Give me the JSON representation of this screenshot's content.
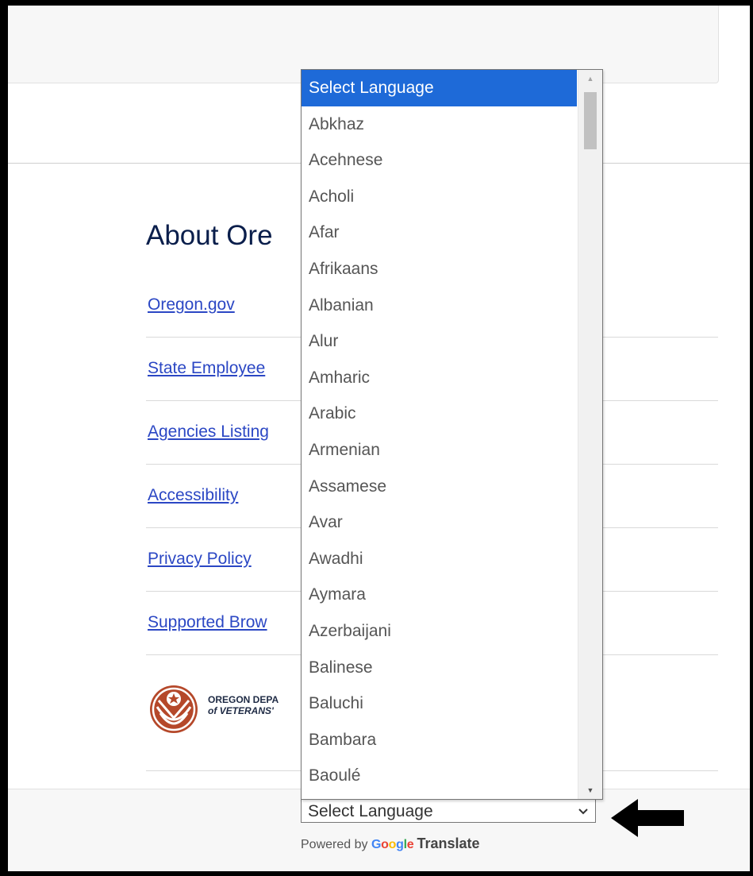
{
  "footer": {
    "heading": "About Ore",
    "links": [
      {
        "label": "Oregon.gov"
      },
      {
        "label": "State Employee"
      },
      {
        "label": "Agencies Listing"
      },
      {
        "label": "Accessibility"
      },
      {
        "label": "Privacy Policy"
      },
      {
        "label": "Supported Brow"
      }
    ],
    "logo": {
      "line1": "OREGON DEPA",
      "line2": "of VETERANS'",
      "color": "#b5482a"
    }
  },
  "translate": {
    "select_value": "Select Language",
    "chevron_icon": "chevron-down-icon",
    "powered_prefix": "Powered by",
    "google": [
      {
        "ch": "G",
        "color": "#4285F4"
      },
      {
        "ch": "o",
        "color": "#EA4335"
      },
      {
        "ch": "o",
        "color": "#FBBC05"
      },
      {
        "ch": "g",
        "color": "#4285F4"
      },
      {
        "ch": "l",
        "color": "#34A853"
      },
      {
        "ch": "e",
        "color": "#EA4335"
      }
    ],
    "translate_word": "Translate"
  },
  "dropdown": {
    "selected_index": 0,
    "accent": "#1e6ad8",
    "options": [
      "Select Language",
      "Abkhaz",
      "Acehnese",
      "Acholi",
      "Afar",
      "Afrikaans",
      "Albanian",
      "Alur",
      "Amharic",
      "Arabic",
      "Armenian",
      "Assamese",
      "Avar",
      "Awadhi",
      "Aymara",
      "Azerbaijani",
      "Balinese",
      "Baluchi",
      "Bambara",
      "Baoulé"
    ],
    "scroll_up_icon": "scroll-up-arrow-icon",
    "scroll_down_icon": "scroll-down-arrow-icon"
  },
  "annotation": {
    "arrow_icon": "left-arrow-icon"
  }
}
